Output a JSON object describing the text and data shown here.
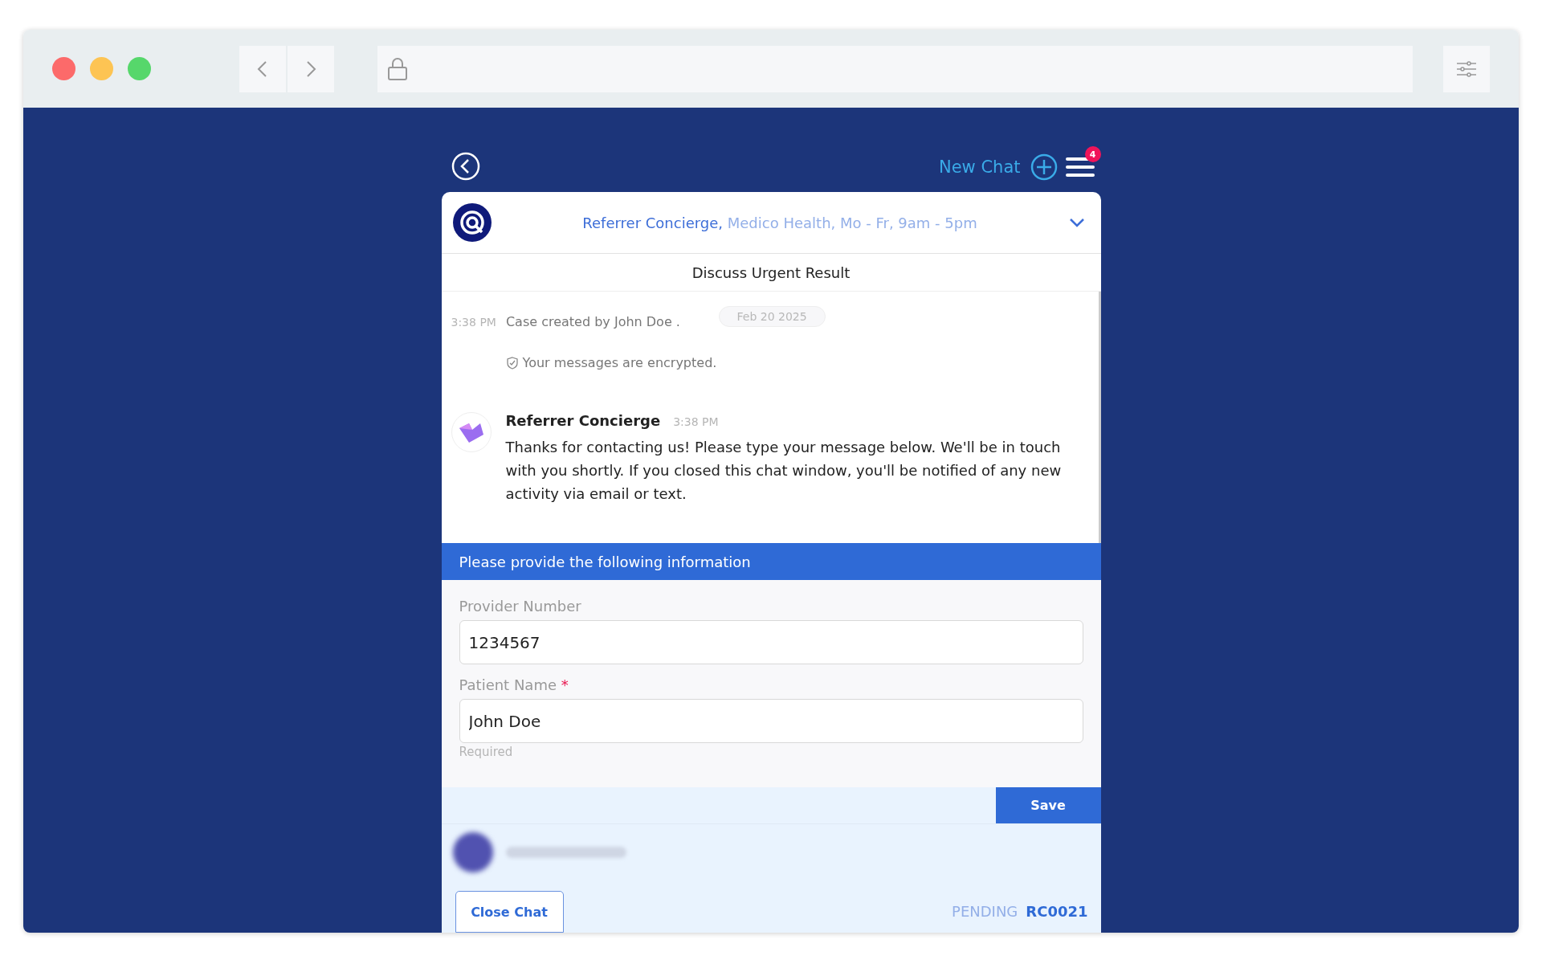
{
  "top": {
    "new_chat": "New Chat",
    "badge": "4"
  },
  "header": {
    "team": "Referrer Concierge,",
    "details": "Medico Health, Mo - Fr, 9am - 5pm",
    "expanded": false
  },
  "subject": "Discuss Urgent Result",
  "events": [
    {
      "time": "3:38 PM",
      "text": "Case created by John Doe .",
      "date": "Feb 20 2025"
    }
  ],
  "notice": "Your messages are encrypted.",
  "messages": [
    {
      "sender": "Referrer Concierge",
      "time": "3:38 PM",
      "text": "Thanks for contacting us! Please type your message below. We'll be in touch with you shortly. If you closed this chat window, you'll be notified of any new activity via email or text."
    }
  ],
  "form": {
    "title": "Please provide the following information",
    "fields": [
      {
        "label": "Provider Number",
        "value": "1234567"
      },
      {
        "label": "Patient Name",
        "value": "John Doe",
        "required_mark": "*",
        "hint": "Required"
      }
    ],
    "save": "Save"
  },
  "footer": {
    "close": "Close Chat",
    "status": "PENDING",
    "case_id": "RC0021"
  }
}
